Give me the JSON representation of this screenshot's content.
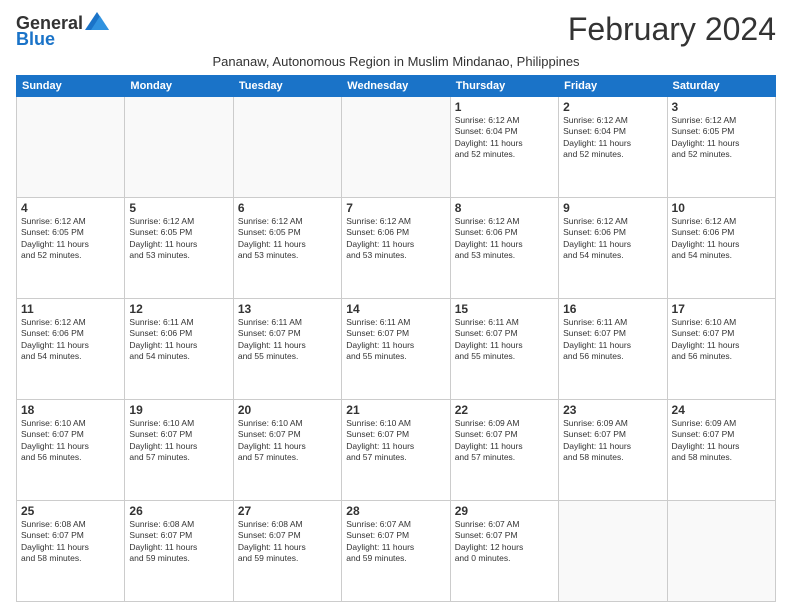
{
  "logo": {
    "line1": "General",
    "line2": "Blue"
  },
  "title": "February 2024",
  "subtitle": "Pananaw, Autonomous Region in Muslim Mindanao, Philippines",
  "days_of_week": [
    "Sunday",
    "Monday",
    "Tuesday",
    "Wednesday",
    "Thursday",
    "Friday",
    "Saturday"
  ],
  "weeks": [
    [
      {
        "day": "",
        "info": ""
      },
      {
        "day": "",
        "info": ""
      },
      {
        "day": "",
        "info": ""
      },
      {
        "day": "",
        "info": ""
      },
      {
        "day": "1",
        "info": "Sunrise: 6:12 AM\nSunset: 6:04 PM\nDaylight: 11 hours\nand 52 minutes."
      },
      {
        "day": "2",
        "info": "Sunrise: 6:12 AM\nSunset: 6:04 PM\nDaylight: 11 hours\nand 52 minutes."
      },
      {
        "day": "3",
        "info": "Sunrise: 6:12 AM\nSunset: 6:05 PM\nDaylight: 11 hours\nand 52 minutes."
      }
    ],
    [
      {
        "day": "4",
        "info": "Sunrise: 6:12 AM\nSunset: 6:05 PM\nDaylight: 11 hours\nand 52 minutes."
      },
      {
        "day": "5",
        "info": "Sunrise: 6:12 AM\nSunset: 6:05 PM\nDaylight: 11 hours\nand 53 minutes."
      },
      {
        "day": "6",
        "info": "Sunrise: 6:12 AM\nSunset: 6:05 PM\nDaylight: 11 hours\nand 53 minutes."
      },
      {
        "day": "7",
        "info": "Sunrise: 6:12 AM\nSunset: 6:06 PM\nDaylight: 11 hours\nand 53 minutes."
      },
      {
        "day": "8",
        "info": "Sunrise: 6:12 AM\nSunset: 6:06 PM\nDaylight: 11 hours\nand 53 minutes."
      },
      {
        "day": "9",
        "info": "Sunrise: 6:12 AM\nSunset: 6:06 PM\nDaylight: 11 hours\nand 54 minutes."
      },
      {
        "day": "10",
        "info": "Sunrise: 6:12 AM\nSunset: 6:06 PM\nDaylight: 11 hours\nand 54 minutes."
      }
    ],
    [
      {
        "day": "11",
        "info": "Sunrise: 6:12 AM\nSunset: 6:06 PM\nDaylight: 11 hours\nand 54 minutes."
      },
      {
        "day": "12",
        "info": "Sunrise: 6:11 AM\nSunset: 6:06 PM\nDaylight: 11 hours\nand 54 minutes."
      },
      {
        "day": "13",
        "info": "Sunrise: 6:11 AM\nSunset: 6:07 PM\nDaylight: 11 hours\nand 55 minutes."
      },
      {
        "day": "14",
        "info": "Sunrise: 6:11 AM\nSunset: 6:07 PM\nDaylight: 11 hours\nand 55 minutes."
      },
      {
        "day": "15",
        "info": "Sunrise: 6:11 AM\nSunset: 6:07 PM\nDaylight: 11 hours\nand 55 minutes."
      },
      {
        "day": "16",
        "info": "Sunrise: 6:11 AM\nSunset: 6:07 PM\nDaylight: 11 hours\nand 56 minutes."
      },
      {
        "day": "17",
        "info": "Sunrise: 6:10 AM\nSunset: 6:07 PM\nDaylight: 11 hours\nand 56 minutes."
      }
    ],
    [
      {
        "day": "18",
        "info": "Sunrise: 6:10 AM\nSunset: 6:07 PM\nDaylight: 11 hours\nand 56 minutes."
      },
      {
        "day": "19",
        "info": "Sunrise: 6:10 AM\nSunset: 6:07 PM\nDaylight: 11 hours\nand 57 minutes."
      },
      {
        "day": "20",
        "info": "Sunrise: 6:10 AM\nSunset: 6:07 PM\nDaylight: 11 hours\nand 57 minutes."
      },
      {
        "day": "21",
        "info": "Sunrise: 6:10 AM\nSunset: 6:07 PM\nDaylight: 11 hours\nand 57 minutes."
      },
      {
        "day": "22",
        "info": "Sunrise: 6:09 AM\nSunset: 6:07 PM\nDaylight: 11 hours\nand 57 minutes."
      },
      {
        "day": "23",
        "info": "Sunrise: 6:09 AM\nSunset: 6:07 PM\nDaylight: 11 hours\nand 58 minutes."
      },
      {
        "day": "24",
        "info": "Sunrise: 6:09 AM\nSunset: 6:07 PM\nDaylight: 11 hours\nand 58 minutes."
      }
    ],
    [
      {
        "day": "25",
        "info": "Sunrise: 6:08 AM\nSunset: 6:07 PM\nDaylight: 11 hours\nand 58 minutes."
      },
      {
        "day": "26",
        "info": "Sunrise: 6:08 AM\nSunset: 6:07 PM\nDaylight: 11 hours\nand 59 minutes."
      },
      {
        "day": "27",
        "info": "Sunrise: 6:08 AM\nSunset: 6:07 PM\nDaylight: 11 hours\nand 59 minutes."
      },
      {
        "day": "28",
        "info": "Sunrise: 6:07 AM\nSunset: 6:07 PM\nDaylight: 11 hours\nand 59 minutes."
      },
      {
        "day": "29",
        "info": "Sunrise: 6:07 AM\nSunset: 6:07 PM\nDaylight: 12 hours\nand 0 minutes."
      },
      {
        "day": "",
        "info": ""
      },
      {
        "day": "",
        "info": ""
      }
    ]
  ]
}
